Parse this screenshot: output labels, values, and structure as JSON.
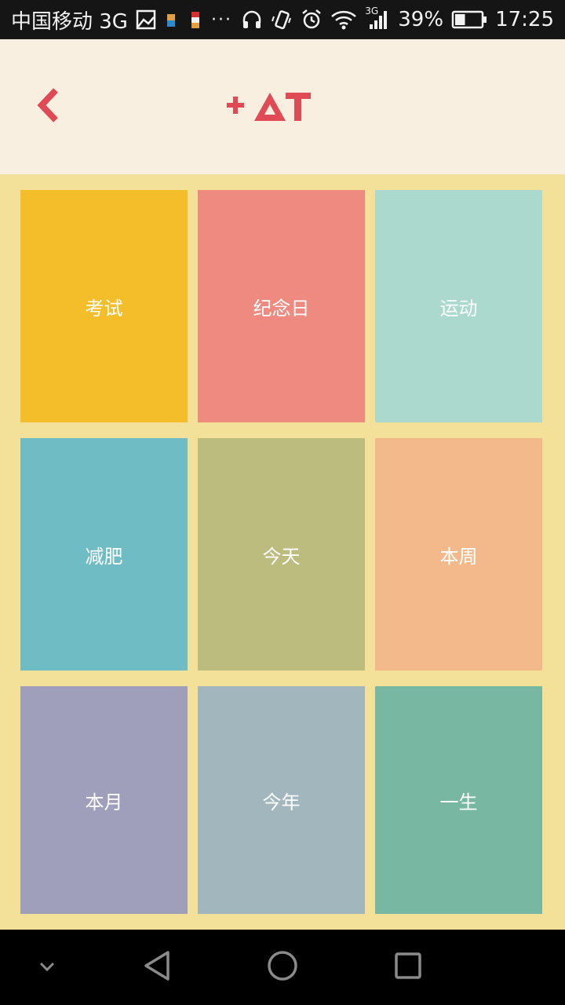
{
  "status_bar": {
    "carrier": "中国移动 3G",
    "more": "···",
    "network": "3G",
    "battery": "39%",
    "battery_level": 0.39,
    "time": "17:25",
    "icons": [
      "image-icon",
      "app-notification-icon",
      "app-notification-icon",
      "headphones-icon",
      "vibrate-icon",
      "alarm-icon",
      "wifi-icon",
      "signal-icon",
      "battery-icon"
    ]
  },
  "header": {
    "back_icon": "chevron-left-icon",
    "logo_icon": "plus-at-logo",
    "accent": "#e04a55"
  },
  "categories": [
    {
      "label": "考试",
      "color": "#f4be2b"
    },
    {
      "label": "纪念日",
      "color": "#ee8a80"
    },
    {
      "label": "运动",
      "color": "#abd9ce"
    },
    {
      "label": "减肥",
      "color": "#6fbcc4"
    },
    {
      "label": "今天",
      "color": "#bbbc7d"
    },
    {
      "label": "本周",
      "color": "#f3b98b"
    },
    {
      "label": "本月",
      "color": "#9f9fbc"
    },
    {
      "label": "今年",
      "color": "#a1b6bd"
    },
    {
      "label": "一生",
      "color": "#78b8a3"
    }
  ],
  "nav_bar": {
    "icons": [
      "chevron-down-icon",
      "back-triangle-icon",
      "home-circle-icon",
      "recents-square-icon"
    ]
  }
}
